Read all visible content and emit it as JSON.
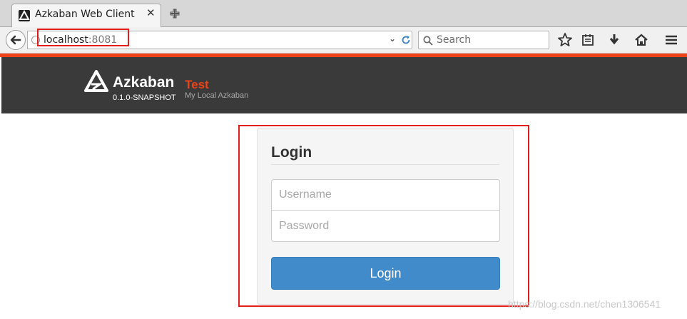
{
  "browser": {
    "tab": {
      "title": "Azkaban Web Client",
      "close_glyph": "✕",
      "favicon": "azkaban-logo-icon"
    },
    "new_tab_icon": "plus-icon",
    "url": {
      "host": "localhost",
      "port": ":8081",
      "dropdown_glyph": "⌄"
    },
    "search": {
      "placeholder": "Search"
    },
    "toolbar_icons": [
      "star-icon",
      "reading-list-icon",
      "download-icon",
      "home-icon",
      "menu-icon"
    ],
    "accent_color": "#ef4216",
    "highlight_color": "#e51c1c"
  },
  "header": {
    "brand": "Azkaban",
    "version": "0.1.0-SNAPSHOT",
    "env_name": "Test",
    "env_description": "My Local Azkaban",
    "background": "#3a3a3a"
  },
  "login": {
    "title": "Login",
    "username_placeholder": "Username",
    "password_placeholder": "Password",
    "button_label": "Login",
    "button_color": "#428bca"
  },
  "watermark": "https://blog.csdn.net/chen1306541"
}
